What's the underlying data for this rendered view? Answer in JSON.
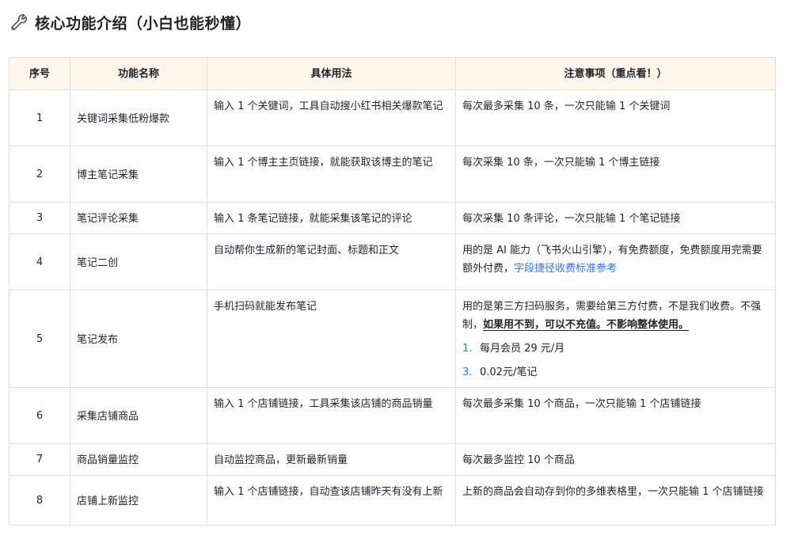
{
  "header": {
    "icon": "wrench-icon",
    "title": "核心功能介绍（小白也能秒懂）"
  },
  "table": {
    "columns": [
      "序号",
      "功能名称",
      "具体用法",
      "注意事项（重点看！）"
    ],
    "rows": [
      {
        "no": "1",
        "name": "关键词采集低粉爆款",
        "usage": "输入 1 个关键词，工具自动搜小红书相关爆款笔记",
        "note": "每次最多采集 10 条，一次只能输 1 个关键词"
      },
      {
        "no": "2",
        "name": "博主笔记采集",
        "usage": "输入 1 个博主主页链接，就能获取该博主的笔记",
        "note": "每次采集 10 条，一次只能输 1 个博主链接"
      },
      {
        "no": "3",
        "name": "笔记评论采集",
        "usage": "输入 1 条笔记链接，就能采集该笔记的评论",
        "note": "每次采集 10 条评论，一次只能输 1 个笔记链接"
      },
      {
        "no": "4",
        "name": "笔记二创",
        "usage": "自动帮你生成新的笔记封面、标题和正文",
        "note": "用的是 AI 能力（飞书火山引擎），有免费额度，免费额度用完需要额外付费，",
        "note_link": "字段捷径收费标准参考"
      },
      {
        "no": "5",
        "name": "笔记发布",
        "usage": "手机扫码就能发布笔记",
        "note": "用的是第三方扫码服务，需要给第三方付费，不是我们收费。不强制，",
        "note_bold": "如果用不到，可以不充值。不影响整体使用。",
        "note_list": [
          {
            "num": "1.",
            "text": "每月会员 29 元/月"
          },
          {
            "num": "3.",
            "text": "0.02元/笔记"
          }
        ]
      },
      {
        "no": "6",
        "name": "采集店铺商品",
        "usage": "输入 1 个店铺链接，工具采集该店铺的商品销量",
        "note": "每次最多采集 10 个商品，一次只能输 1 个店铺链接"
      },
      {
        "no": "7",
        "name": "商品销量监控",
        "usage": "自动监控商品，更新最新销量",
        "note": "每次最多监控 10 个商品"
      },
      {
        "no": "8",
        "name": "店铺上新监控",
        "usage": "输入 1 个店铺链接，自动查该店铺昨天有没有上新",
        "note": "上新的商品会自动存到你的多维表格里，一次只能输 1 个店铺链接"
      }
    ]
  },
  "colors": {
    "header_bg": "#fff6ec",
    "border": "#dee0e3",
    "link": "#3370ff"
  }
}
